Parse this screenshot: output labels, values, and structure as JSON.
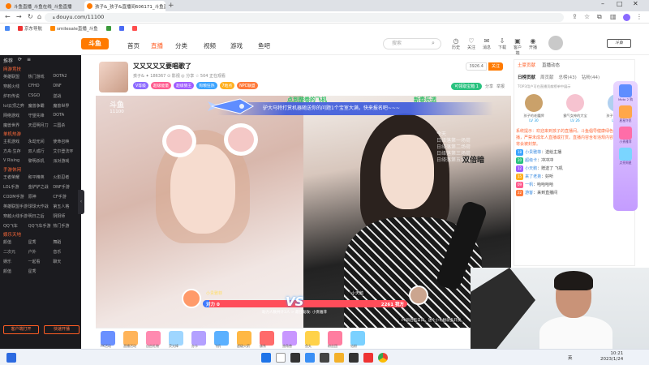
{
  "browser": {
    "tabs": [
      {
        "title": "斗鱼直播_斗鱼在线_斗鱼直播",
        "active": false
      },
      {
        "title": "孩子&_孩子&直播间606171_斗鱼直播",
        "active": true
      }
    ],
    "new_tab": "+",
    "url": "douyu.com/11100",
    "bookmarks": [
      "京东导航",
      "smilesale直播_斗鱼"
    ]
  },
  "header": {
    "logo": "斗鱼",
    "nav": [
      "首页",
      "直播",
      "分类",
      "视频",
      "游戏",
      "鱼吧"
    ],
    "active_nav": "直播",
    "search_placeholder": "搜索",
    "icons": [
      {
        "name": "history-icon",
        "label": "历史"
      },
      {
        "name": "follow-icon",
        "label": "关注"
      },
      {
        "name": "message-icon",
        "label": "消息"
      },
      {
        "name": "download-icon",
        "label": "下载"
      },
      {
        "name": "app-icon",
        "label": "客户端"
      },
      {
        "name": "live-start-icon",
        "label": "开播"
      }
    ]
  },
  "sidebar": {
    "top": [
      "推荐",
      "⟳",
      "≡"
    ],
    "sections": [
      {
        "title": "网游竞技",
        "items": [
          "英雄联盟",
          "热门游戏",
          "DOTA2",
          "穿越火线",
          "CFHD",
          "DNF",
          "炉石传说",
          "CSGO",
          "逆战",
          "lol云顶之弈",
          "魔兽争霸",
          "魔兽世界",
          "网络游戏",
          "守望先锋",
          "DOTA",
          "魔兽世界",
          "天涯明月刀",
          "三国杀"
        ]
      },
      {
        "title": "单机热游",
        "items": [
          "主机游戏",
          "永劫无间",
          "使命召唤",
          "方舟:生存",
          "双人成行",
          "艾尔登法环",
          "V Rising",
          "黎明杀机",
          "派对游戏"
        ]
      },
      {
        "title": "手游休闲",
        "items": [
          "王者荣耀",
          "和平精英",
          "火影忍者",
          "LOL手游",
          "金铲铲之战",
          "DNF手游",
          "CODM手游",
          "原神",
          "CF手游",
          "英雄联盟手游",
          "球球大作战",
          "第五人格",
          "穿越火线手游",
          "明日之后",
          "阴阳师",
          "QQ飞车",
          "QQ飞车手游",
          "热门手游"
        ]
      },
      {
        "title": "娱乐天地",
        "items": [
          "颜值",
          "星秀",
          "舞蹈",
          "二次元",
          "户外",
          "音乐",
          "娱乐",
          "一起看",
          "聊天",
          "颜值",
          "星秀"
        ]
      }
    ],
    "buttons": [
      "客户端打开",
      "快速开播"
    ]
  },
  "room": {
    "title": "又又又又又要唱歌了",
    "meta": "孩子&   ✦ 186367   ⊙ 影视   ◎ 分享   ☆ 504 正在观看",
    "badges": [
      {
        "text": "V等级",
        "color": "#8d6bff"
      },
      {
        "text": "超级能量",
        "color": "#ff5d8f"
      },
      {
        "text": "超级狼王",
        "color": "#a05cff"
      },
      {
        "text": "狗粮狂热",
        "color": "#3aa3ff"
      },
      {
        "text": "7地点",
        "color": "#ffb020"
      },
      {
        "text": "NPC联盟",
        "color": "#ff7a3a"
      }
    ],
    "follow_count": "3926.4",
    "follow_label": "关注",
    "sign_label": "可领取宝箱 1",
    "share_label": "分享",
    "report_label": "举报"
  },
  "video": {
    "room_logo": "斗鱼",
    "room_id": "11100",
    "banner": "驴大马特打赏机器随送你的问题1个宝室大满，快来报名吧~~~",
    "top_texts": [
      "点到整卷的飞机",
      "新春乐透"
    ],
    "overlay_right": "今天\n日绎落第一场荷\n日绎落第二场荷\n日绎落第三场荷\n日绎落第五场荷",
    "overlay_word": "双倍暗",
    "pk": {
      "left_name": "小贵雅菲",
      "right_name": "小天鹅",
      "left_label": "对力",
      "left_score": "0",
      "right_score": "2261",
      "right_label": "我方",
      "left_fraction": 0.03,
      "vs": "VS",
      "tip": "助力人数共计3人 > 最佳助攻: 小贵雅菲"
    },
    "bottom_right_note": "PK目后百日日，送个小礼物就多开我",
    "colors": {
      "pk_blue": "#3e7bff",
      "pk_red": "#ff4d5a"
    }
  },
  "gifts": [
    {
      "name": "PK活动",
      "color": "#6a90ff"
    },
    {
      "name": "直播活动",
      "color": "#ffb45a"
    },
    {
      "name": "自由礼物",
      "color": "#ff8ab0"
    },
    {
      "name": "荧光棒",
      "color": "#9fd6ff"
    },
    {
      "name": "办卡",
      "color": "#b3a0ff"
    },
    {
      "name": "飞机",
      "color": "#5ab0ff"
    },
    {
      "name": "超级火箭",
      "color": "#ffb845"
    },
    {
      "name": "佛系",
      "color": "#ff6b6b"
    },
    {
      "name": "独角兽",
      "color": "#c897ff"
    },
    {
      "name": "鱼丸",
      "color": "#ffd24a"
    },
    {
      "name": "粉丝团",
      "color": "#ff7da0"
    },
    {
      "name": "钻粉",
      "color": "#7bd1ff"
    }
  ],
  "chat": {
    "tabs": [
      "土豪贡献",
      "直播动态"
    ],
    "rank_tabs": [
      "日榜贡献",
      "周贡献",
      "总榜(43)",
      "钻粉(44)"
    ],
    "rank_note": "TOP3用户可在直播贡献榜单中展示",
    "rank": [
      {
        "name": "孩子的老魔牌",
        "lv": "LV 30",
        "color": "#caa16a"
      },
      {
        "name": "霸气女神的大宝",
        "lv": "LV 26",
        "color": "#f6c3d0"
      },
      {
        "name": "孩子&&2601",
        "lv": "LV 25",
        "color": "#b0d0f0"
      }
    ],
    "messages": [
      {
        "kind": "sys",
        "text": "系统提示：欢迎来到孩子的直播间。斗鱼倡导健康绿色直播，严禁未成年人直播或打赏。直播内容含有违规内容的将会被封禁。"
      },
      {
        "kind": "user",
        "lv": "18",
        "user": "小贵雅菲",
        "text": "送给主播"
      },
      {
        "kind": "user",
        "lv": "20",
        "user": "超级卡",
        "text": "冲冲冲"
      },
      {
        "kind": "user",
        "lv": "12",
        "user": "小天鹅",
        "text": "赠送了 飞机"
      },
      {
        "kind": "user",
        "lv": "15",
        "user": "来了老弟",
        "text": "好听"
      },
      {
        "kind": "user",
        "lv": "09",
        "user": "一帆",
        "text": "哈哈哈哈"
      },
      {
        "kind": "user",
        "lv": "22",
        "user": "游客",
        "text": "来到直播间"
      }
    ]
  },
  "side_gifts": [
    {
      "name": "Moto 2 购",
      "color": "#5f8dff"
    },
    {
      "name": "星星许愿",
      "color": "#ffa74a"
    },
    {
      "name": "小贵雅菲",
      "color": "#ff6da8"
    },
    {
      "name": "点亮周星",
      "color": "#7ad5ff"
    }
  ],
  "taskbar": {
    "tray_text": "英",
    "time": "10:21",
    "date": "2023/1/24"
  }
}
